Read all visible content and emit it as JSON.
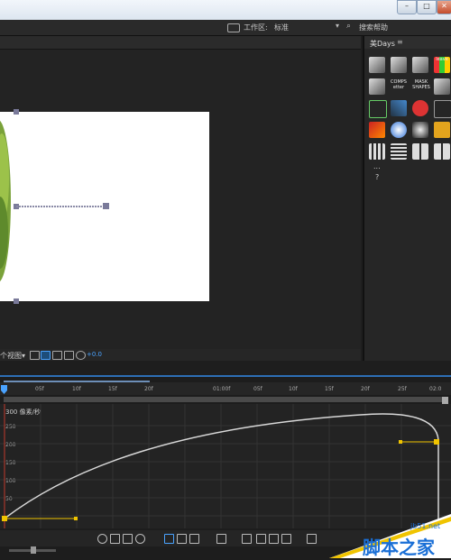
{
  "window": {
    "minimize_glyph": "–",
    "maximize_glyph": "□",
    "close_glyph": "✕"
  },
  "workspace_bar": {
    "label": "工作区:",
    "value": "标准",
    "dropdown_glyph": "▾",
    "search_glyph": "⌕",
    "help_search": "搜索帮助"
  },
  "viewer": {
    "view_select": "个视图▾",
    "value_readout": "+0.0"
  },
  "right_panel": {
    "tab_label": "美Days",
    "menu_glyph": "≡",
    "tools": {
      "leave": "leave",
      "comps_line1": "COMPS",
      "comps_line2": "etter",
      "mask_line1": "MASK",
      "mask_line2": "SHAPES",
      "ellipsis": "...",
      "question": "?"
    }
  },
  "timeline": {
    "ruler_ticks": [
      "05f",
      "10f",
      "15f",
      "20f",
      "01:00f",
      "05f",
      "10f",
      "15f",
      "20f",
      "25f",
      "02:0"
    ],
    "graph_unit": "300 像素/秒",
    "y_labels": [
      "250",
      "200",
      "150",
      "100",
      "50"
    ]
  },
  "colors": {
    "accent_blue": "#2d6fb5",
    "curve": "#d8d8d8",
    "keyframe": "#f0c400",
    "playhead": "#c0392b"
  },
  "watermark": {
    "url": "jb51.net",
    "text": "脚本之家"
  }
}
